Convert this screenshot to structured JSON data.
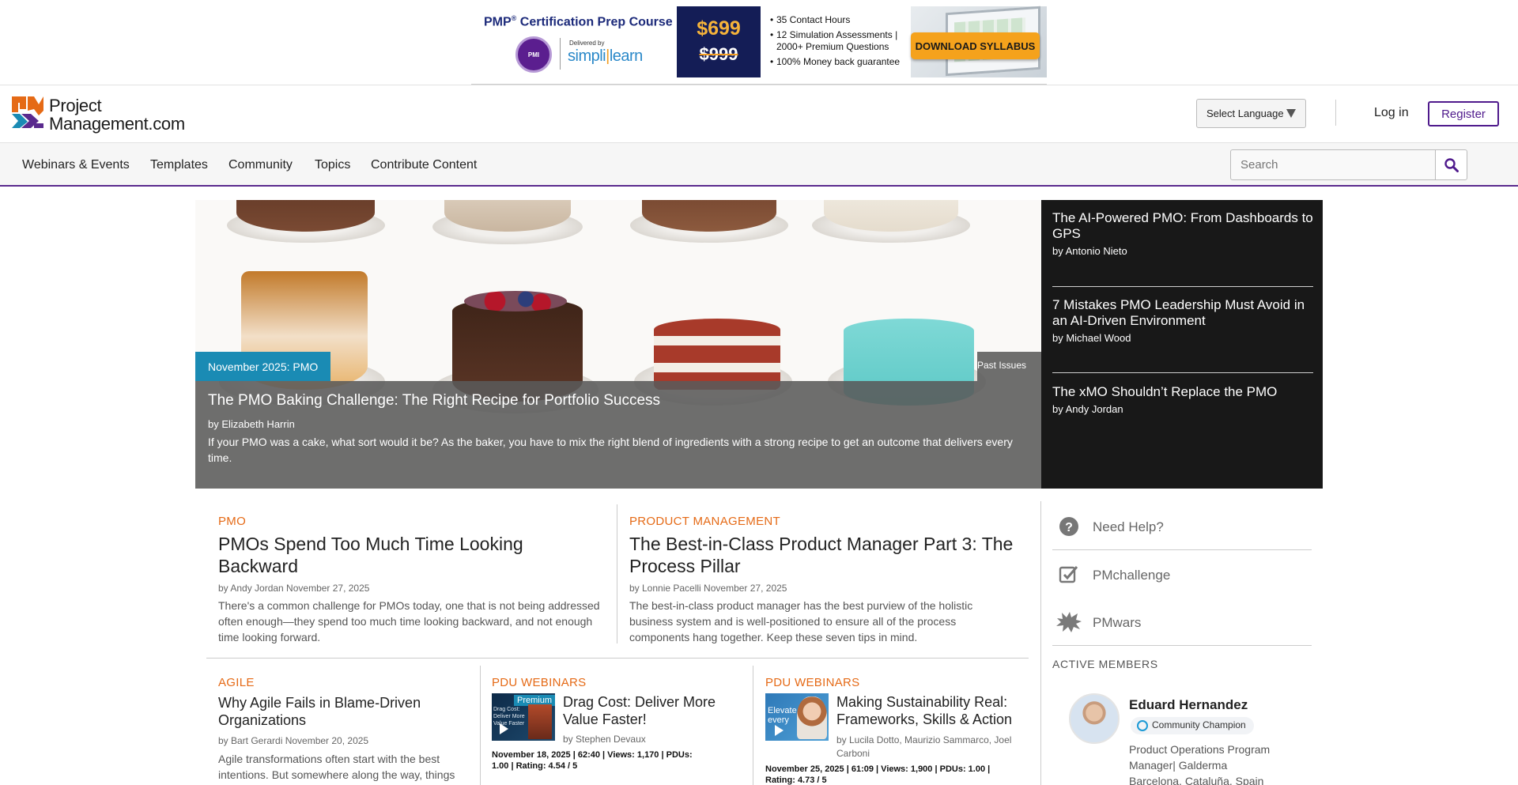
{
  "ad": {
    "title": "PMP",
    "title_reg": "®",
    "title_rest": " Certification Prep Course",
    "delivered_by": "Delivered by",
    "brand_a": "simpli",
    "brand_b": "learn",
    "price_new": "$699",
    "price_old": "$999",
    "bullets": [
      "35 Contact Hours",
      "12 Simulation Assessments | 2000+ Premium Questions",
      "100% Money back guarantee"
    ],
    "cta": "DOWNLOAD SYLLABUS"
  },
  "header": {
    "logo_line1": "Project",
    "logo_line2": "Management.com",
    "language": "Select Language",
    "login": "Log in",
    "register": "Register"
  },
  "nav": {
    "items": [
      "Webinars & Events",
      "Templates",
      "Community",
      "Topics",
      "Contribute Content"
    ],
    "search_placeholder": "Search"
  },
  "hero": {
    "tag": "November 2025: PMO",
    "past_issues": "Past Issues",
    "title": "The PMO Baking Challenge: The Right Recipe for Portfolio Success",
    "by": "by Elizabeth Harrin",
    "description": "If your PMO was a cake, what sort would it be? As the baker, you have to mix the right blend of ingredients with a strong recipe to get an outcome that delivers every time."
  },
  "featured": [
    {
      "title": "The AI-Powered PMO: From Dashboards to GPS",
      "by": "by Antonio Nieto"
    },
    {
      "title": "7 Mistakes PMO Leadership Must Avoid in an AI-Driven Environment",
      "by": "by Michael Wood"
    },
    {
      "title": "The xMO Shouldn’t Replace the PMO",
      "by": "by Andy Jordan"
    }
  ],
  "articles": {
    "a1": {
      "category": "PMO",
      "title": "PMOs Spend Too Much Time Looking Backward",
      "by": "by Andy Jordan November 27, 2025",
      "description": "There's a common challenge for PMOs today, one that is not being addressed often enough—they spend too much time looking backward, and not enough time looking forward."
    },
    "a2": {
      "category": "PRODUCT MANAGEMENT",
      "title": "The Best-in-Class Product Manager Part 3: The Process Pillar",
      "by": "by Lonnie Pacelli November 27, 2025",
      "description": "The best-in-class product manager has the best purview of the holistic business system and is well-positioned to ensure all of the process components hang together. Keep these seven tips in mind."
    },
    "a3": {
      "category": "AGILE",
      "title": "Why Agile Fails in Blame-Driven Organizations",
      "by": "by Bart Gerardi November 20, 2025",
      "description": "Agile transformations often start with the best intentions. But somewhere along the way, things"
    },
    "a4": {
      "category": "PDU WEBINARS",
      "title": "Drag Cost: Deliver More Value Faster!",
      "by": "by Stephen Devaux",
      "stats": "November 18, 2025 | 62:40 | Views: 1,170 | PDUs: 1.00 | Rating: 4.54 / 5",
      "thumb_label": "Premium",
      "thumb_text": "Drag Cost: Deliver More Value Faster"
    },
    "a5": {
      "category": "PDU WEBINARS",
      "title": "Making Sustainability Real: Frameworks, Skills & Action",
      "by": "by Lucila Dotto, Maurizio Sammarco, Joel Carboni",
      "stats": "November 25, 2025 | 61:09 | Views: 1,900 | PDUs: 1.00 | Rating: 4.73 / 5",
      "thumb_text": "Elevate every"
    }
  },
  "sidebar": {
    "links": [
      "Need Help?",
      "PMchallenge",
      "PMwars"
    ],
    "active_members_header": "ACTIVE MEMBERS",
    "member": {
      "name": "Eduard Hernandez",
      "badge": "Community Champion",
      "role": "Product Operations Program Manager| Galderma",
      "location": "Barcelona, Cataluña, Spain"
    }
  },
  "colors": {
    "accent_purple": "#4f1a8c",
    "category_orange": "#e56a16",
    "hero_tag_blue": "#1a8bb4",
    "featured_bg": "#181818"
  }
}
